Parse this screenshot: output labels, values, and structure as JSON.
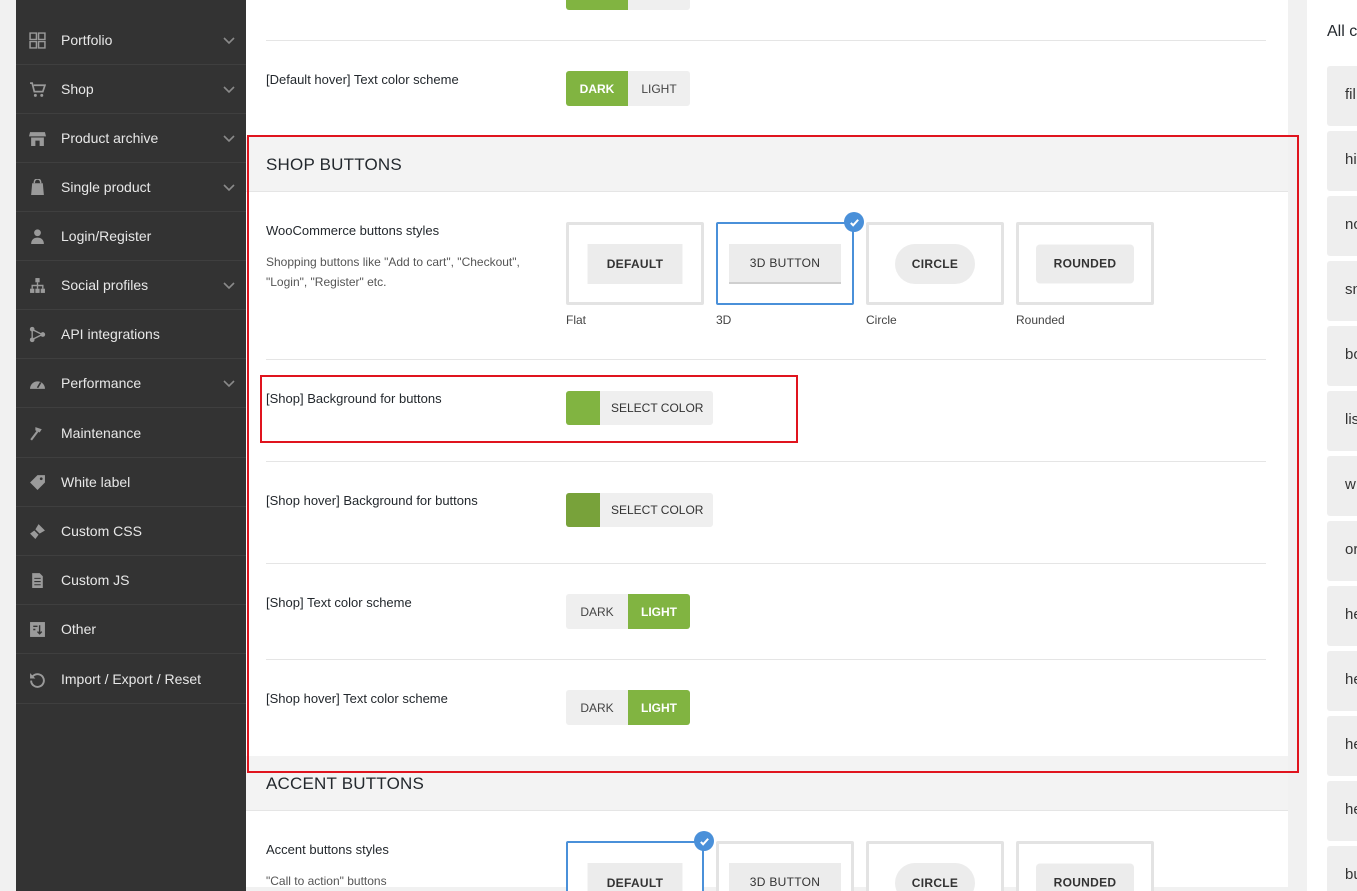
{
  "sidebar": {
    "items": [
      {
        "label": "Portfolio",
        "icon": "portfolio-grid-icon",
        "expandable": true
      },
      {
        "label": "Shop",
        "icon": "cart-icon",
        "expandable": true
      },
      {
        "label": "Product archive",
        "icon": "store-icon",
        "expandable": true
      },
      {
        "label": "Single product",
        "icon": "bag-icon",
        "expandable": true
      },
      {
        "label": "Login/Register",
        "icon": "user-icon",
        "expandable": false
      },
      {
        "label": "Social profiles",
        "icon": "network-icon",
        "expandable": true
      },
      {
        "label": "API integrations",
        "icon": "api-icon",
        "expandable": false
      },
      {
        "label": "Performance",
        "icon": "dashboard-icon",
        "expandable": true
      },
      {
        "label": "Maintenance",
        "icon": "hammer-icon",
        "expandable": false
      },
      {
        "label": "White label",
        "icon": "tag-icon",
        "expandable": false
      },
      {
        "label": "Custom CSS",
        "icon": "brush-icon",
        "expandable": false
      },
      {
        "label": "Custom JS",
        "icon": "file-icon",
        "expandable": false
      },
      {
        "label": "Other",
        "icon": "other-icon",
        "expandable": false
      },
      {
        "label": "Import / Export / Reset",
        "icon": "reset-icon",
        "expandable": false
      }
    ]
  },
  "main": {
    "default_hover": {
      "title": "[Default hover] Text color scheme",
      "options": [
        "DARK",
        "LIGHT"
      ],
      "selected": "DARK"
    },
    "shop_buttons": {
      "heading": "SHOP BUTTONS",
      "styles": {
        "title": "WooCommerce buttons styles",
        "description": "Shopping buttons like \"Add to cart\", \"Checkout\", \"Login\", \"Register\" etc.",
        "cards": [
          {
            "label": "DEFAULT",
            "caption": "Flat"
          },
          {
            "label": "3D BUTTON",
            "caption": "3D"
          },
          {
            "label": "CIRCLE",
            "caption": "Circle"
          },
          {
            "label": "ROUNDED",
            "caption": "Rounded"
          }
        ],
        "selected": "3D"
      },
      "bg": {
        "title": "[Shop] Background for buttons",
        "button": "SELECT COLOR",
        "color": "#81b441"
      },
      "hover_bg": {
        "title": "[Shop hover] Background for buttons",
        "button": "SELECT COLOR",
        "color": "#78a23a"
      },
      "text": {
        "title": "[Shop] Text color scheme",
        "options": [
          "DARK",
          "LIGHT"
        ],
        "selected": "LIGHT"
      },
      "hover_text": {
        "title": "[Shop hover] Text color scheme",
        "options": [
          "DARK",
          "LIGHT"
        ],
        "selected": "LIGHT"
      }
    },
    "accent_buttons": {
      "heading": "ACCENT BUTTONS",
      "styles": {
        "title": "Accent buttons styles",
        "description": "\"Call to action\" buttons",
        "cards": [
          {
            "label": "DEFAULT"
          },
          {
            "label": "3D BUTTON"
          },
          {
            "label": "CIRCLE"
          },
          {
            "label": "ROUNDED"
          }
        ],
        "selected": "DEFAULT"
      }
    }
  },
  "right_panel": {
    "title": "All c",
    "items": [
      "fil",
      "hi",
      "nc",
      "sn",
      "bo",
      "lis",
      "w",
      "or",
      "he",
      "he",
      "he",
      "he",
      "bu"
    ]
  },
  "colors": {
    "accent": "#81b441",
    "accent_hover": "#78a23a",
    "highlight": "#e0141e",
    "selected_border": "#4a90d9"
  }
}
